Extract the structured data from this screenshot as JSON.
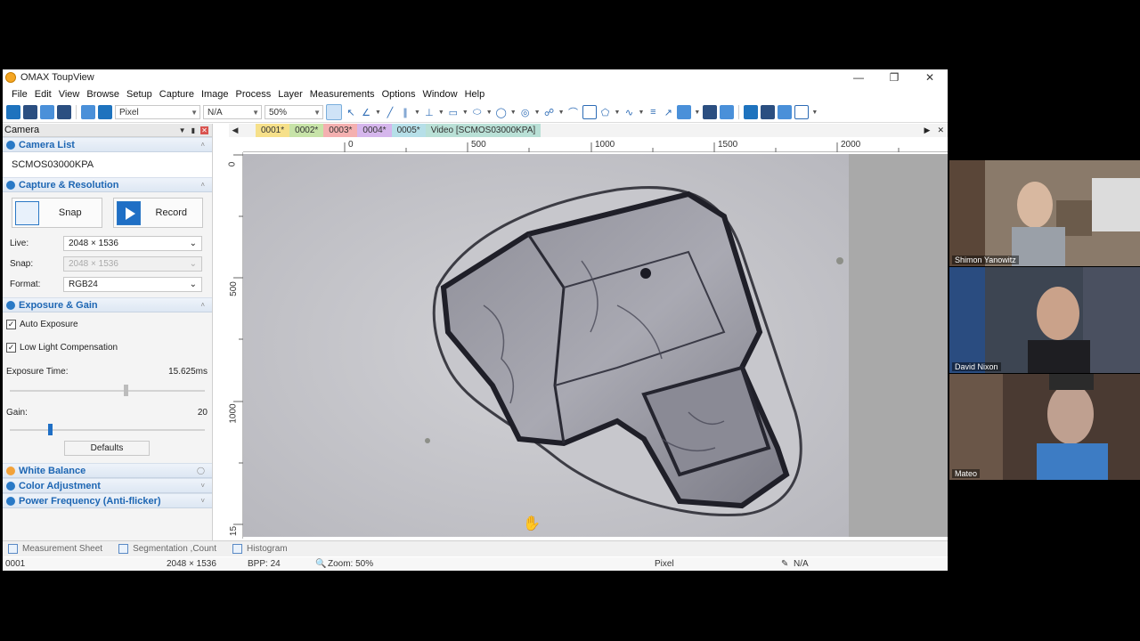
{
  "window": {
    "title": "OMAX ToupView"
  },
  "menu": [
    "File",
    "Edit",
    "View",
    "Browse",
    "Setup",
    "Capture",
    "Image",
    "Process",
    "Layer",
    "Measurements",
    "Options",
    "Window",
    "Help"
  ],
  "toolbar": {
    "unit": "Pixel",
    "magnification": "N/A",
    "zoom": "50%"
  },
  "left_panel": {
    "header": "Camera",
    "camera_list": {
      "title": "Camera List",
      "device": "SCMOS03000KPA"
    },
    "capture": {
      "title": "Capture & Resolution",
      "snap_label": "Snap",
      "record_label": "Record",
      "live_label": "Live:",
      "live_value": "2048 × 1536",
      "snap_res_label": "Snap:",
      "snap_value": "2048 × 1536",
      "format_label": "Format:",
      "format_value": "RGB24"
    },
    "exposure": {
      "title": "Exposure & Gain",
      "auto_exposure": "Auto Exposure",
      "low_light": "Low Light Compensation",
      "exposure_time_label": "Exposure Time:",
      "exposure_time_value": "15.625ms",
      "exposure_slider_fraction": 0.6,
      "gain_label": "Gain:",
      "gain_value": "20",
      "gain_slider_fraction": 0.2,
      "defaults_label": "Defaults"
    },
    "sections": [
      "White Balance",
      "Color Adjustment",
      "Power Frequency (Anti-flicker)"
    ]
  },
  "tabs": [
    {
      "label": "0001*",
      "color": "#f6e08a"
    },
    {
      "label": "0002*",
      "color": "#c7e3a8"
    },
    {
      "label": "0003*",
      "color": "#f4b0b0"
    },
    {
      "label": "0004*",
      "color": "#d5b6ec"
    },
    {
      "label": "0005*",
      "color": "#b6dfe8"
    },
    {
      "label": "Video [SCMOS03000KPA]",
      "color": "#b9e0d6"
    }
  ],
  "ruler": {
    "h_labels": [
      "0",
      "500",
      "1000",
      "1500",
      "2000"
    ],
    "v_labels": [
      "0",
      "500",
      "1000",
      "15"
    ]
  },
  "bottom_tabs": [
    "Measurement Sheet",
    "Segmentation ,Count",
    "Histogram"
  ],
  "status": {
    "doc": "0001",
    "size": "2048 × 1536",
    "bpp": "BPP: 24",
    "zoom": "Zoom: 50%",
    "unit": "Pixel",
    "mag": "N/A"
  },
  "participants": [
    "Shimon Yanowitz",
    "David Nixon",
    "Mateo"
  ]
}
